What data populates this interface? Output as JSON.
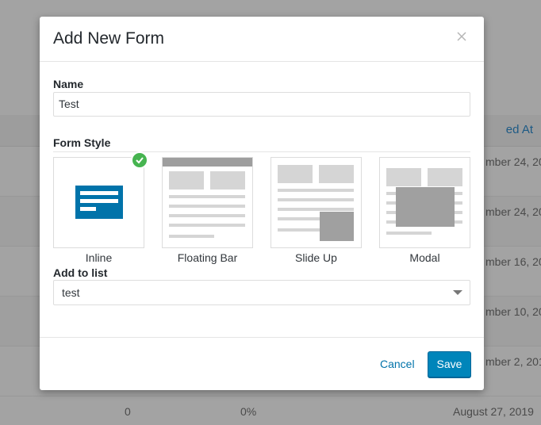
{
  "background": {
    "header_fragment": "ed At",
    "rows": [
      {
        "date": "mber 24, 20"
      },
      {
        "date": "mber 24, 20"
      },
      {
        "date": "mber 16, 20"
      },
      {
        "date": "mber 10, 20"
      },
      {
        "date": "mber 2, 201"
      }
    ],
    "last_row": {
      "count": "0",
      "rate": "0%",
      "date": "August 27, 2019"
    }
  },
  "modal": {
    "title": "Add New Form",
    "close_icon": "close-icon",
    "name_label": "Name",
    "name_value": "Test",
    "form_style_label": "Form Style",
    "styles": [
      {
        "label": "Inline",
        "selected": true,
        "icon": "inline-form-icon"
      },
      {
        "label": "Floating Bar",
        "selected": false,
        "icon": "floating-bar-icon"
      },
      {
        "label": "Slide Up",
        "selected": false,
        "icon": "slide-up-icon"
      },
      {
        "label": "Modal",
        "selected": false,
        "icon": "modal-icon"
      }
    ],
    "list_label": "Add to list",
    "list_value": "test",
    "cancel_label": "Cancel",
    "save_label": "Save"
  },
  "colors": {
    "accent": "#0085ba",
    "inline_icon": "#0073aa",
    "check": "#46b450",
    "overlay": "#a3a3a3"
  }
}
